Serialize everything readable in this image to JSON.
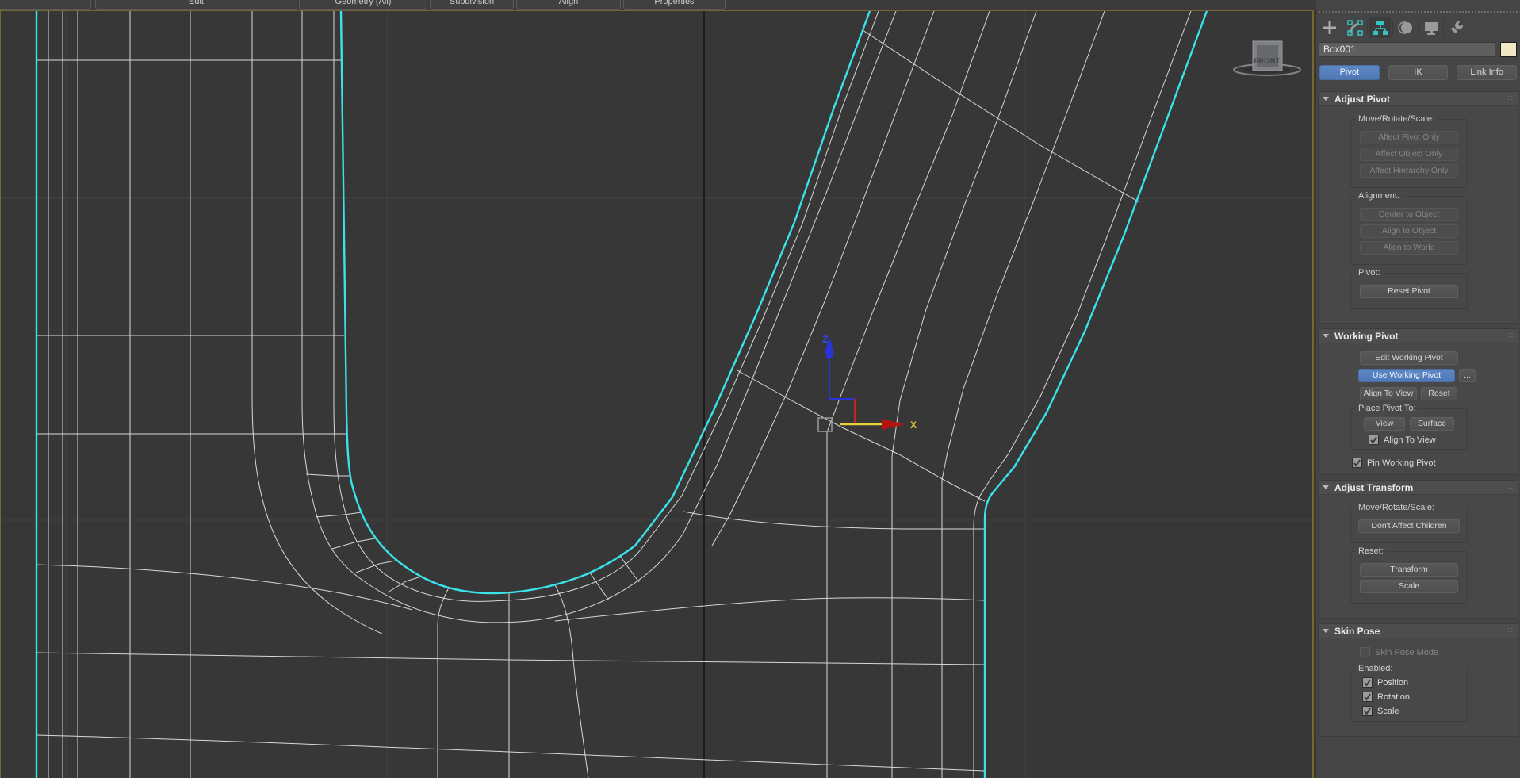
{
  "ribbon": {
    "edit": "Edit",
    "geometry": "Geometry (All)",
    "subdivision": "Subdivision",
    "align": "Align",
    "properties": "Properties",
    "dropdown_arrow": "▾"
  },
  "viewport": {
    "viewcube_label": "FRONT",
    "gizmo_x_label": "X",
    "gizmo_z_label": "Z"
  },
  "panel": {
    "object_name": "Box001",
    "mode_tabs": {
      "pivot": "Pivot",
      "ik": "IK",
      "link_info": "Link Info"
    },
    "adjust_pivot": {
      "title": "Adjust Pivot",
      "mrs_label": "Move/Rotate/Scale:",
      "affect_pivot_only": "Affect Pivot Only",
      "affect_object_only": "Affect Object Only",
      "affect_hierarchy_only": "Affect Hierarchy Only",
      "alignment_label": "Alignment:",
      "center_to_object": "Center to Object",
      "align_to_object": "Align to Object",
      "align_to_world": "Align to World",
      "pivot_label": "Pivot:",
      "reset_pivot": "Reset Pivot"
    },
    "working_pivot": {
      "title": "Working Pivot",
      "edit_working_pivot": "Edit Working Pivot",
      "use_working_pivot": "Use Working Pivot",
      "more": "...",
      "align_to_view": "Align To View",
      "reset": "Reset",
      "place_pivot_label": "Place Pivot To:",
      "view": "View",
      "surface": "Surface",
      "align_to_view_checkbox": "Align To View",
      "pin_working_pivot": "Pin Working Pivot"
    },
    "adjust_transform": {
      "title": "Adjust Transform",
      "mrs_label": "Move/Rotate/Scale:",
      "dont_affect_children": "Don't Affect Children",
      "reset_label": "Reset:",
      "transform": "Transform",
      "scale": "Scale"
    },
    "skin_pose": {
      "title": "Skin Pose",
      "skin_pose_mode": "Skin Pose Mode",
      "enabled_label": "Enabled:",
      "position": "Position",
      "rotation": "Rotation",
      "scale": "Scale"
    }
  },
  "colors": {
    "selection_cyan": "#3ae2ea",
    "accent_blue": "#567fbe",
    "viewport_border_olive": "#75682c",
    "object_color_swatch": "#efe7c6",
    "wireframe": "#d8d8d8"
  }
}
